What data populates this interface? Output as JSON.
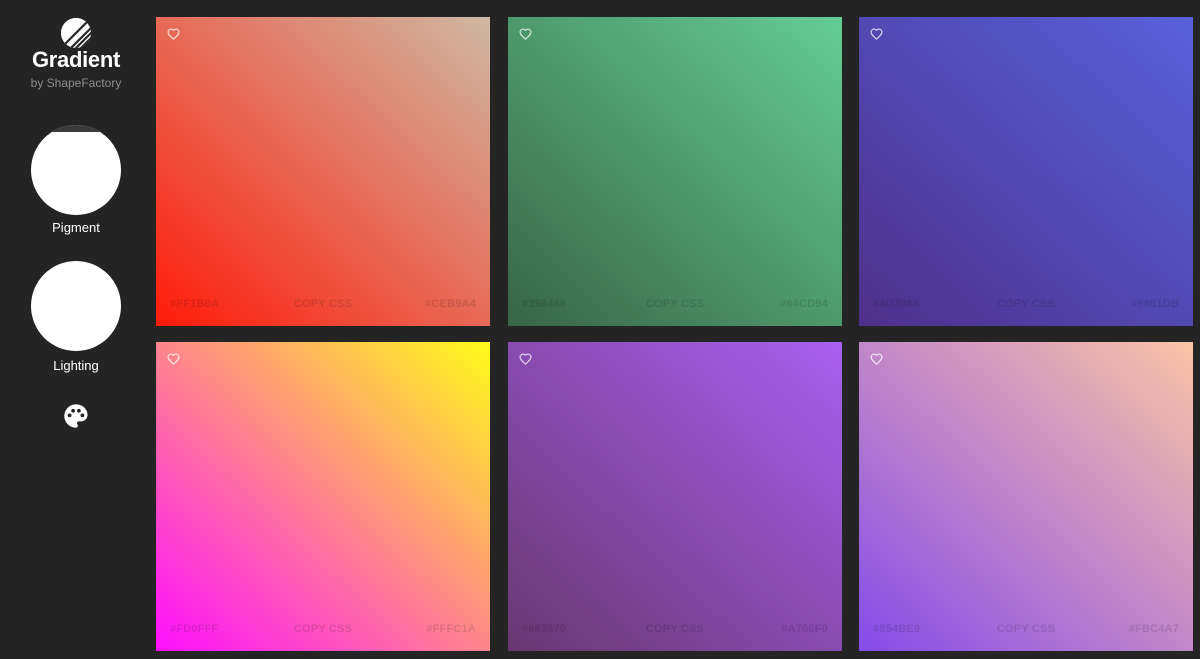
{
  "brand": {
    "title": "Gradient",
    "subtitle": "by ShapeFactory",
    "logo_icon": "logo-mark"
  },
  "modes": [
    {
      "label": "Pigment",
      "icon": "circle-swatch"
    },
    {
      "label": "Lighting",
      "icon": "circle-swatch"
    }
  ],
  "palette_icon": "palette-icon",
  "copy_label": "COPY CSS",
  "cards": [
    {
      "start": "#FF1B0A",
      "end": "#CEB9A4",
      "direction": "to top right"
    },
    {
      "start": "#396448",
      "end": "#64CD94",
      "direction": "to top right"
    },
    {
      "start": "#4D308A",
      "end": "#5861DB",
      "direction": "to top right"
    },
    {
      "start": "#FD0FFF",
      "end": "#FFFC1A",
      "direction": "to top right"
    },
    {
      "start": "#683870",
      "end": "#A760F0",
      "direction": "to top right"
    },
    {
      "start": "#854BE9",
      "end": "#FBC4A7",
      "direction": "to top right"
    }
  ]
}
